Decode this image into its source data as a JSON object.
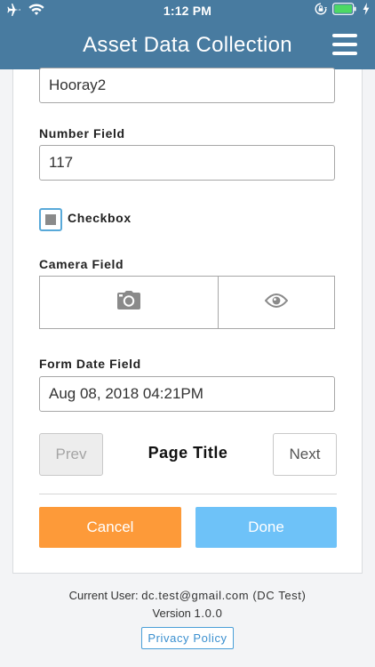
{
  "status_bar": {
    "time": "1:12 PM",
    "icons": [
      "airplane-icon",
      "wifi-icon",
      "orientation-lock-icon",
      "battery-icon",
      "charging-bolt-icon"
    ],
    "battery_color": "#4cd964"
  },
  "header": {
    "title": "Asset Data Collection",
    "background_color": "#487ba0",
    "menu_icon": "hamburger-menu-icon"
  },
  "form": {
    "text_field_value": "Hooray2",
    "number_field": {
      "label": "Number Field",
      "value": "117"
    },
    "checkbox": {
      "label": "Checkbox",
      "checked": true
    },
    "camera_field": {
      "label": "Camera Field",
      "icons": [
        "camera-icon",
        "eye-icon"
      ]
    },
    "date_field": {
      "label": "Form Date Field",
      "value": "Aug 08, 2018 04:21PM"
    },
    "pager": {
      "prev_label": "Prev",
      "page_title": "Page Title",
      "next_label": "Next"
    },
    "actions": {
      "cancel_label": "Cancel",
      "cancel_color": "#fd9a39",
      "done_label": "Done",
      "done_color": "#6ec2f8"
    }
  },
  "footer": {
    "user_prefix": "Current User: ",
    "user_value": "dc.test@gmail.com (DC Test)",
    "version_prefix": "Version ",
    "version_value": "1.0.0",
    "privacy_label": "Privacy Policy"
  }
}
